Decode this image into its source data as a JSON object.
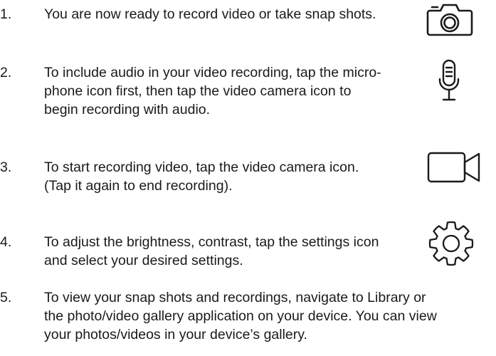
{
  "steps": [
    {
      "number": "1.",
      "lines": [
        "You are now ready to record video or take snap shots."
      ],
      "icon": "camera-icon"
    },
    {
      "number": "2.",
      "lines": [
        "To include audio in your video recording, tap the micro-",
        "phone icon first, then tap the video camera icon to",
        "begin recording with audio."
      ],
      "icon": "microphone-icon"
    },
    {
      "number": "3.",
      "lines": [
        "To start recording video, tap the video camera icon.",
        "(Tap it again to end recording)."
      ],
      "icon": "video-camera-icon"
    },
    {
      "number": "4.",
      "lines": [
        "To adjust the brightness, contrast, tap the settings icon",
        "and select your desired settings."
      ],
      "icon": "gear-icon"
    },
    {
      "number": "5.",
      "lines": [
        "To view your snap shots and recordings, navigate to Library or",
        "the photo/video gallery application on your device. You can view",
        "your photos/videos in your device’s gallery."
      ]
    }
  ]
}
